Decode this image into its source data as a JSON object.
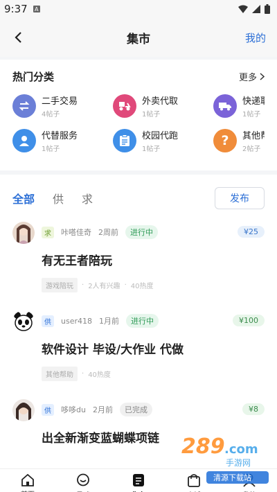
{
  "status_bar": {
    "time": "9:37",
    "sim_label": "A"
  },
  "header": {
    "title": "集市",
    "right_link": "我的"
  },
  "categories": {
    "heading": "热门分类",
    "more": "更多",
    "items": [
      {
        "name": "二手交易",
        "count": "4帖子",
        "icon": "swap-icon",
        "color": "#6b7fd7"
      },
      {
        "name": "外卖代取",
        "count": "1帖子",
        "icon": "delivery-scooter-icon",
        "color": "#e0497a"
      },
      {
        "name": "快递取",
        "count": "1帖子",
        "icon": "truck-icon",
        "color": "#7b63d8"
      },
      {
        "name": "代替服务",
        "count": "1帖子",
        "icon": "person-icon",
        "color": "#3f8fe8"
      },
      {
        "name": "校园代跑",
        "count": "1帖子",
        "icon": "clipboard-icon",
        "color": "#3f8fe8"
      },
      {
        "name": "其他帮",
        "count": "2帖子",
        "icon": "question-icon",
        "color": "#f08c3a"
      }
    ]
  },
  "feed": {
    "tabs": [
      "全部",
      "供",
      "求"
    ],
    "publish": "发布",
    "posts": [
      {
        "type": "求",
        "user": "咔嗒佳奇",
        "time": "2周前",
        "status": "进行中",
        "price": "¥25",
        "title": "有无王者陪玩",
        "tag": "游戏陪玩",
        "interest": "2人有兴趣",
        "heat": "40热度"
      },
      {
        "type": "供",
        "user": "user418",
        "time": "1月前",
        "status": "进行中",
        "price": "¥100",
        "title": "软件设计 毕设/大作业 代做",
        "tag": "其他帮助",
        "interest": "",
        "heat": "40热度"
      },
      {
        "type": "供",
        "user": "哆哆du",
        "time": "2月前",
        "status": "已完成",
        "price": "¥8",
        "title": "出全新渐变蓝蝴蝶项链",
        "tag": "",
        "interest": "",
        "heat": ""
      }
    ]
  },
  "bottom_nav": [
    "首页",
    "星球",
    "集市",
    "商城",
    "我的"
  ],
  "watermark": {
    "logo": "289.com",
    "sub": "手游网",
    "brand": "清源下载站"
  }
}
